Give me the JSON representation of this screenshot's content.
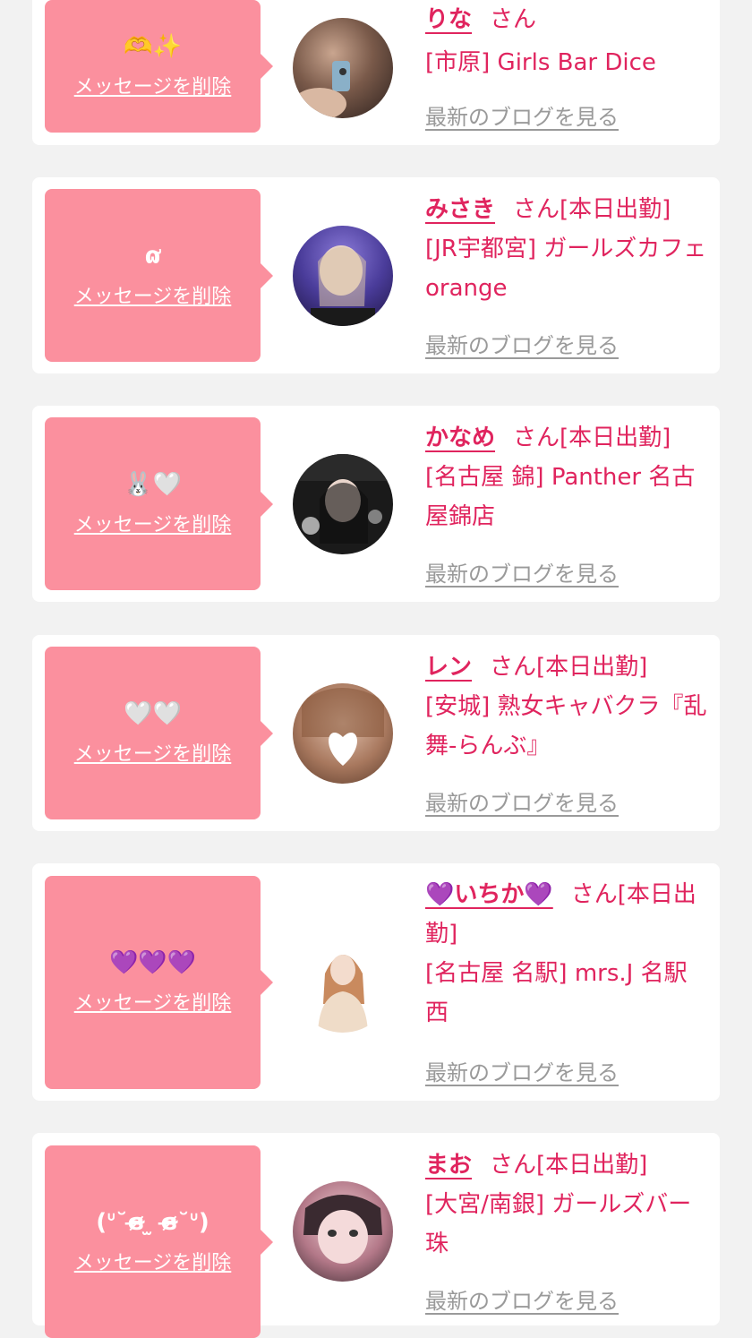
{
  "delete_label": "メッセージを削除",
  "blog_label": "最新のブログを見る",
  "san_suffix": "さん",
  "cards": [
    {
      "message": "🫶✨",
      "name": "りな",
      "status": "",
      "shop": "[市原] Girls Bar Dice"
    },
    {
      "message": "ɷ̛",
      "name": "みさき",
      "status": "[本日出勤]",
      "shop": "[JR宇都宮] ガールズカフェ orange"
    },
    {
      "message": "🐰🤍",
      "name": "かなめ",
      "status": "[本日出勤]",
      "shop": "[名古屋 錦] Panther 名古屋錦店"
    },
    {
      "message": "🤍🤍",
      "name": "レン",
      "status": "[本日出勤]",
      "shop": "[安城] 熟女キャバクラ『乱舞-らんぶ』"
    },
    {
      "message": "💜💜💜",
      "name": "💜いちか💜",
      "status": "[本日出勤]",
      "shop": "[名古屋 名駅] mrs.J 名駅西"
    },
    {
      "message": "(ᐡ˘ɞ̴̶̷ ̫ ɞ̴̶̷˘ᐡ)",
      "name": "まお",
      "status": "[本日出勤]",
      "shop": "[大宮/南銀] ガールズバー 珠"
    }
  ]
}
